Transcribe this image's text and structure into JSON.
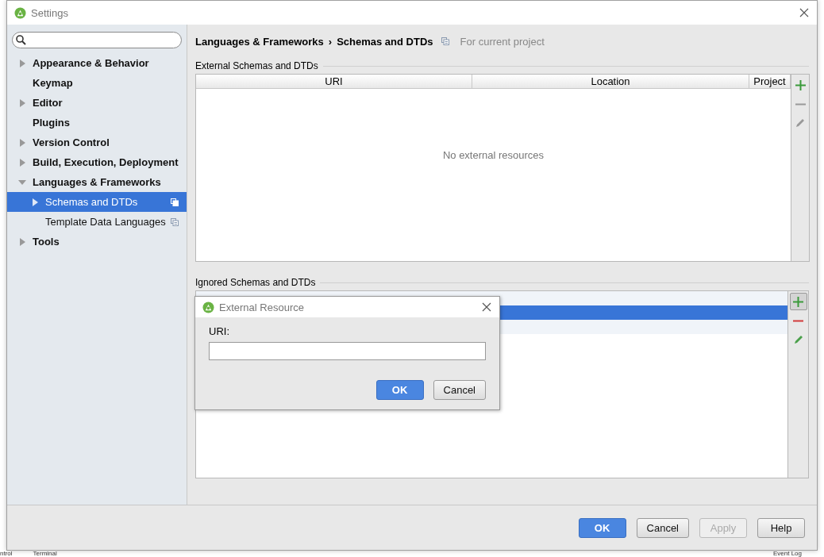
{
  "window": {
    "title": "Settings"
  },
  "sidebar": {
    "items": [
      {
        "label": "Appearance & Behavior",
        "expanded": false,
        "selected": false
      },
      {
        "label": "Keymap",
        "selected": false
      },
      {
        "label": "Editor",
        "expanded": false,
        "selected": false
      },
      {
        "label": "Plugins",
        "selected": false
      },
      {
        "label": "Version Control",
        "expanded": false,
        "selected": false
      },
      {
        "label": "Build, Execution, Deployment",
        "expanded": false,
        "selected": false
      },
      {
        "label": "Languages & Frameworks",
        "expanded": true,
        "selected": false,
        "children": [
          {
            "label": "Schemas and DTDs",
            "expanded": false,
            "selected": true,
            "project_scope": true
          },
          {
            "label": "Template Data Languages",
            "selected": false,
            "project_scope": true
          }
        ]
      },
      {
        "label": "Tools",
        "expanded": false,
        "selected": false
      }
    ]
  },
  "breadcrumb": {
    "items": [
      "Languages & Frameworks",
      "Schemas and DTDs"
    ],
    "separator": "›",
    "scope_note": "For current project"
  },
  "external_section": {
    "title": "External Schemas and DTDs",
    "columns": [
      "URI",
      "Location",
      "Project"
    ],
    "empty_text": "No external resources",
    "tools": [
      {
        "kind": "add",
        "disabled": false,
        "pressed": false
      },
      {
        "kind": "remove",
        "disabled": true,
        "pressed": false
      },
      {
        "kind": "edit",
        "disabled": true,
        "pressed": false
      }
    ]
  },
  "ignored_section": {
    "title": "Ignored Schemas and DTDs",
    "rows": [
      {
        "selected": false
      },
      {
        "selected": true
      },
      {
        "selected": false
      }
    ],
    "tools": [
      {
        "kind": "add",
        "disabled": false,
        "pressed": true
      },
      {
        "kind": "remove",
        "disabled": false,
        "pressed": false
      },
      {
        "kind": "edit",
        "disabled": false,
        "pressed": false
      }
    ]
  },
  "dialog": {
    "title": "External Resource",
    "field_label": "URI:",
    "buttons": [
      {
        "label": "OK",
        "primary": true,
        "disabled": false
      },
      {
        "label": "Cancel",
        "primary": false,
        "disabled": false
      }
    ]
  },
  "buttons": [
    {
      "label": "OK",
      "primary": true,
      "disabled": false
    },
    {
      "label": "Cancel",
      "primary": false,
      "disabled": false
    },
    {
      "label": "Apply",
      "primary": false,
      "disabled": true
    },
    {
      "label": "Help",
      "primary": false,
      "disabled": false
    }
  ],
  "ide_status_bar": [
    "ntrol",
    "Terminal",
    "Event Log"
  ]
}
